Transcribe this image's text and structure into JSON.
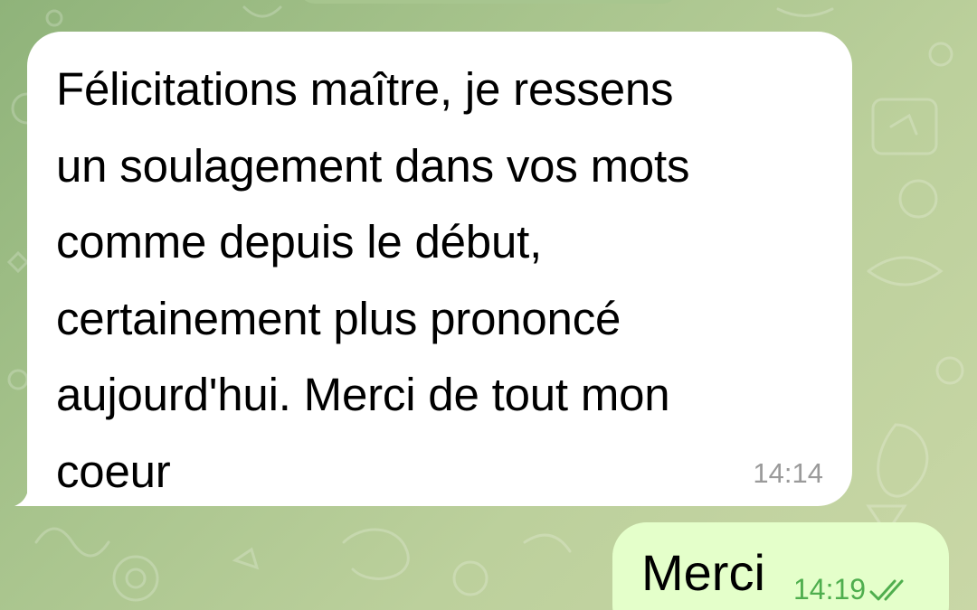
{
  "chat": {
    "messages": [
      {
        "direction": "incoming",
        "text": "Félicitations maître, je ressens\nun soulagement dans vos mots\ncomme depuis le début,\ncertainement plus prononcé\naujourd'hui. Merci de tout mon\ncoeur",
        "time": "14:14"
      },
      {
        "direction": "outgoing",
        "text": "Merci",
        "time": "14:19",
        "status_icon": "double-check-icon"
      }
    ]
  },
  "colors": {
    "wallpaper": "#a8c48d",
    "incoming_bubble": "#ffffff",
    "outgoing_bubble": "#e4ffca",
    "outgoing_meta": "#4fae4e",
    "incoming_time": "#9a9a9a"
  }
}
